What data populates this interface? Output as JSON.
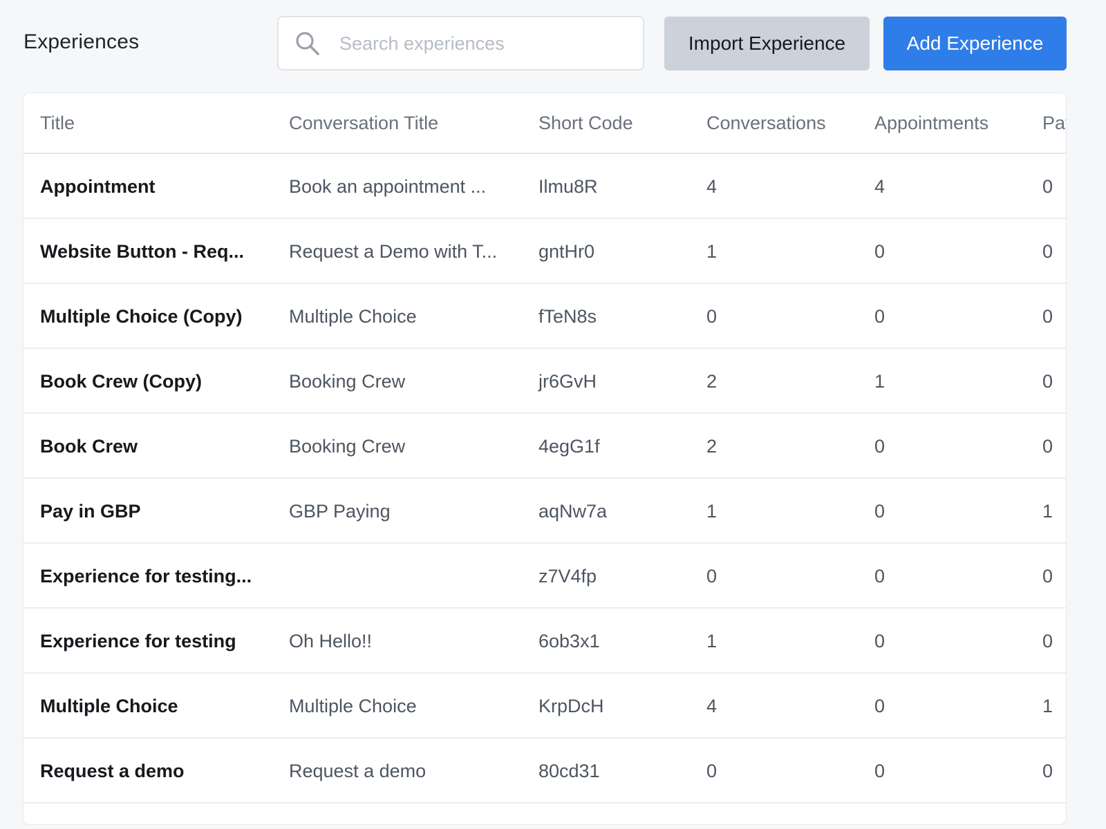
{
  "header": {
    "title": "Experiences",
    "search_placeholder": "Search experiences",
    "search_value": "",
    "import_label": "Import Experience",
    "add_label": "Add Experience"
  },
  "colors": {
    "primary": "#2f7de9",
    "secondary": "#ccd1da",
    "background": "#f6f7f9"
  },
  "icons": {
    "search": "search-icon"
  },
  "table": {
    "columns": [
      "Title",
      "Conversation Title",
      "Short Code",
      "Conversations",
      "Appointments",
      "Pay"
    ],
    "rows": [
      {
        "title": "Appointment",
        "conversation_title": "Book an appointment ...",
        "short_code": "Ilmu8R",
        "conversations": "4",
        "appointments": "4",
        "pay": "0"
      },
      {
        "title": "Website Button - Req...",
        "conversation_title": "Request a Demo with T...",
        "short_code": "gntHr0",
        "conversations": "1",
        "appointments": "0",
        "pay": "0"
      },
      {
        "title": "Multiple Choice (Copy)",
        "conversation_title": "Multiple Choice",
        "short_code": "fTeN8s",
        "conversations": "0",
        "appointments": "0",
        "pay": "0"
      },
      {
        "title": "Book Crew (Copy)",
        "conversation_title": "Booking Crew",
        "short_code": "jr6GvH",
        "conversations": "2",
        "appointments": "1",
        "pay": "0"
      },
      {
        "title": "Book Crew",
        "conversation_title": "Booking Crew",
        "short_code": "4egG1f",
        "conversations": "2",
        "appointments": "0",
        "pay": "0"
      },
      {
        "title": "Pay in GBP",
        "conversation_title": "GBP Paying",
        "short_code": "aqNw7a",
        "conversations": "1",
        "appointments": "0",
        "pay": "1"
      },
      {
        "title": "Experience for testing...",
        "conversation_title": "",
        "short_code": "z7V4fp",
        "conversations": "0",
        "appointments": "0",
        "pay": "0"
      },
      {
        "title": "Experience for testing",
        "conversation_title": "Oh Hello!!",
        "short_code": "6ob3x1",
        "conversations": "1",
        "appointments": "0",
        "pay": "0"
      },
      {
        "title": "Multiple Choice",
        "conversation_title": "Multiple Choice",
        "short_code": "KrpDcH",
        "conversations": "4",
        "appointments": "0",
        "pay": "1"
      },
      {
        "title": "Request a demo",
        "conversation_title": "Request a demo",
        "short_code": "80cd31",
        "conversations": "0",
        "appointments": "0",
        "pay": "0"
      }
    ]
  }
}
